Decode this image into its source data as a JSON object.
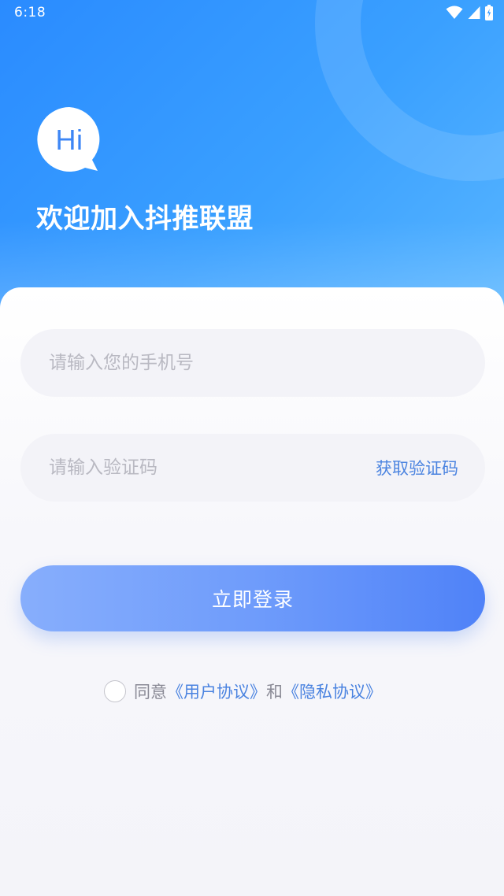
{
  "status_bar": {
    "time": "6:18",
    "icons": [
      "wifi-icon",
      "signal-icon",
      "battery-icon"
    ]
  },
  "header": {
    "badge_text": "Hi",
    "title": "欢迎加入抖推联盟"
  },
  "form": {
    "phone_placeholder": "请输入您的手机号",
    "code_placeholder": "请输入验证码",
    "get_code_label": "获取验证码",
    "login_label": "立即登录"
  },
  "agreement": {
    "prefix": "同意",
    "user_agreement": "《用户协议》",
    "conjunction": "和",
    "privacy_agreement": "《隐私协议》",
    "checked": false
  },
  "colors": {
    "header_gradient_start": "#2a8bff",
    "header_gradient_end": "#59b6ff",
    "accent": "#4a83e0",
    "button_start": "#87aefc",
    "button_end": "#4f82f8"
  }
}
